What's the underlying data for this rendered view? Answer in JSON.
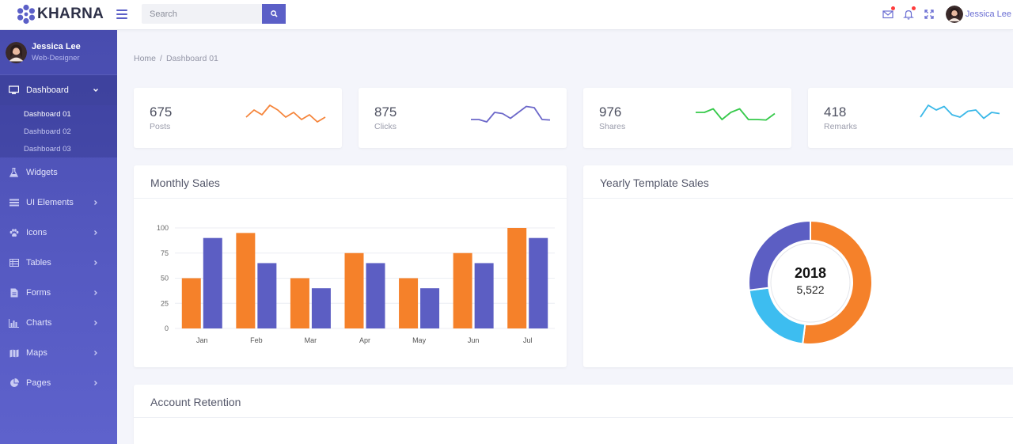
{
  "brand": {
    "name": "KHARNA",
    "accent": "#5b5fc7"
  },
  "search": {
    "placeholder": "Search"
  },
  "topbar": {
    "user_name": "Jessica Lee",
    "icons": [
      "mail-icon",
      "bell-icon",
      "fullscreen-icon"
    ]
  },
  "profile": {
    "name": "Jessica Lee",
    "role": "Web-Designer"
  },
  "sidebar": {
    "items": [
      {
        "label": "Dashboard",
        "icon": "monitor-icon",
        "active": true,
        "expanded": true,
        "children": [
          "Dashboard 01",
          "Dashboard 02",
          "Dashboard 03"
        ],
        "active_child": "Dashboard 01"
      },
      {
        "label": "Widgets",
        "icon": "flask-icon"
      },
      {
        "label": "UI Elements",
        "icon": "list-icon"
      },
      {
        "label": "Icons",
        "icon": "paw-icon"
      },
      {
        "label": "Tables",
        "icon": "table-icon"
      },
      {
        "label": "Forms",
        "icon": "file-icon"
      },
      {
        "label": "Charts",
        "icon": "bar-chart-icon"
      },
      {
        "label": "Maps",
        "icon": "map-icon"
      },
      {
        "label": "Pages",
        "icon": "pie-icon"
      }
    ]
  },
  "breadcrumb": {
    "home": "Home",
    "separator": "/",
    "current": "Dashboard 01"
  },
  "stats": [
    {
      "value": "675",
      "label": "Posts",
      "color": "#f5843a",
      "spark": [
        4,
        7,
        5,
        9,
        7,
        4,
        6,
        3,
        5,
        2,
        4
      ]
    },
    {
      "value": "875",
      "label": "Clicks",
      "color": "#6b67c9",
      "spark": [
        3,
        3,
        2,
        6,
        5.5,
        3.5,
        6,
        8.5,
        8,
        3,
        2.8
      ]
    },
    {
      "value": "976",
      "label": "Shares",
      "color": "#35c94a",
      "spark": [
        6,
        6,
        7.5,
        3,
        6,
        7.5,
        3,
        3,
        2.8,
        5.5
      ]
    },
    {
      "value": "418",
      "label": "Remarks",
      "color": "#3ab8e8",
      "spark": [
        4,
        9,
        7,
        8.5,
        5,
        4,
        6.5,
        7,
        3.5,
        6,
        5.5
      ]
    }
  ],
  "monthly_sales": {
    "title": "Monthly Sales",
    "chart_data": {
      "type": "bar",
      "categories": [
        "Jan",
        "Feb",
        "Mar",
        "Apr",
        "May",
        "Jun",
        "Jul"
      ],
      "series": [
        {
          "color": "#f5812a",
          "values": [
            50,
            95,
            50,
            75,
            50,
            75,
            100
          ]
        },
        {
          "color": "#5c5ec3",
          "values": [
            90,
            65,
            40,
            65,
            40,
            65,
            90
          ]
        }
      ],
      "yticks": [
        "0",
        "25",
        "50",
        "75",
        "100"
      ],
      "ylim": [
        0,
        100
      ],
      "grid": true
    }
  },
  "yearly_sales": {
    "title": "Yearly Template Sales",
    "center_year": "2018",
    "center_value": "5,522",
    "chart_data": {
      "type": "pie",
      "slices": [
        {
          "value": 52,
          "color": "#f5812a"
        },
        {
          "value": 21,
          "color": "#3dbdf0"
        },
        {
          "value": 27,
          "color": "#5c5ec3"
        }
      ]
    }
  },
  "account_retention": {
    "title": "Account Retention"
  }
}
